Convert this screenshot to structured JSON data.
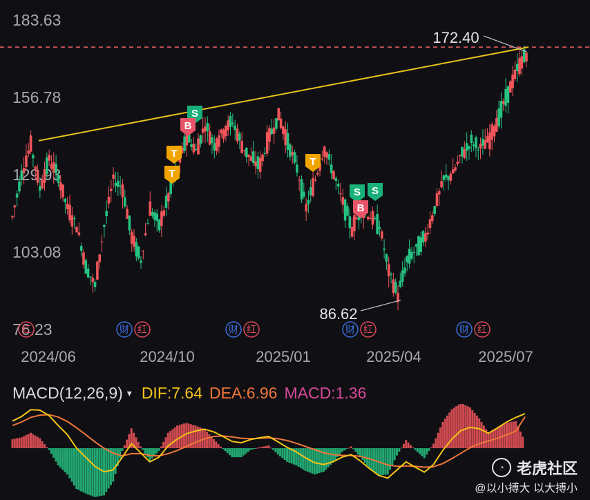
{
  "colors": {
    "background": "#101014",
    "up": "#f0555a",
    "down": "#26c281",
    "trendline": "#e8c21a",
    "ref_line": "#e35d5d",
    "axis_text": "#a8a8b0",
    "dif": "#f5c518",
    "dea": "#f0763a",
    "macd": "#d64a9a",
    "badge_T": "#f0a500",
    "badge_S": "#19b07a",
    "badge_B": "#ea5468",
    "event_blue": "#3c6fe0",
    "event_red": "#e0485a"
  },
  "chart_data": [
    {
      "type": "candlestick",
      "y_ticks": [
        "183.63",
        "156.78",
        "129.93",
        "103.08",
        "76.23"
      ],
      "ylim": [
        76.23,
        183.63
      ],
      "x_ticks": [
        "2024/06",
        "2024/10",
        "2025/01",
        "2025/04",
        "2025/07"
      ],
      "annotations": {
        "high_label": "172.40",
        "high_value": 172.4,
        "low_label": "86.62",
        "low_value": 86.62
      },
      "reference_line": 174.0,
      "trendline": {
        "start": [
          "2024/06",
          141.5
        ],
        "end": [
          "2025/07",
          174.0
        ]
      },
      "series": [
        {
          "d": "2024/05",
          "v": 115
        },
        {
          "d": "2024/06",
          "v": 130
        },
        {
          "d": "2024/06",
          "v": 140
        },
        {
          "d": "2024/06",
          "v": 125
        },
        {
          "d": "2024/06",
          "v": 135
        },
        {
          "d": "2024/06",
          "v": 129
        },
        {
          "d": "2024/07",
          "v": 118
        },
        {
          "d": "2024/07",
          "v": 112
        },
        {
          "d": "2024/07",
          "v": 98
        },
        {
          "d": "2024/07",
          "v": 91
        },
        {
          "d": "2024/08",
          "v": 112
        },
        {
          "d": "2024/08",
          "v": 128
        },
        {
          "d": "2024/08",
          "v": 125
        },
        {
          "d": "2024/09",
          "v": 108
        },
        {
          "d": "2024/09",
          "v": 100
        },
        {
          "d": "2024/09",
          "v": 118
        },
        {
          "d": "2024/09",
          "v": 112
        },
        {
          "d": "2024/10",
          "v": 122
        },
        {
          "d": "2024/10",
          "v": 132
        },
        {
          "d": "2024/10",
          "v": 143
        },
        {
          "d": "2024/10",
          "v": 138
        },
        {
          "d": "2024/11",
          "v": 147
        },
        {
          "d": "2024/11",
          "v": 140
        },
        {
          "d": "2024/11",
          "v": 145
        },
        {
          "d": "2024/12",
          "v": 148
        },
        {
          "d": "2024/12",
          "v": 140
        },
        {
          "d": "2024/12",
          "v": 135
        },
        {
          "d": "2024/12",
          "v": 133
        },
        {
          "d": "2025/01",
          "v": 143
        },
        {
          "d": "2025/01",
          "v": 150
        },
        {
          "d": "2025/01",
          "v": 141
        },
        {
          "d": "2025/01",
          "v": 132
        },
        {
          "d": "2025/02",
          "v": 118
        },
        {
          "d": "2025/02",
          "v": 128
        },
        {
          "d": "2025/02",
          "v": 139
        },
        {
          "d": "2025/02",
          "v": 130
        },
        {
          "d": "2025/03",
          "v": 120
        },
        {
          "d": "2025/03",
          "v": 111
        },
        {
          "d": "2025/03",
          "v": 118
        },
        {
          "d": "2025/03",
          "v": 115
        },
        {
          "d": "2025/03",
          "v": 112
        },
        {
          "d": "2025/04",
          "v": 96
        },
        {
          "d": "2025/04",
          "v": 88
        },
        {
          "d": "2025/04",
          "v": 100
        },
        {
          "d": "2025/04",
          "v": 104
        },
        {
          "d": "2025/04",
          "v": 108
        },
        {
          "d": "2025/05",
          "v": 118
        },
        {
          "d": "2025/05",
          "v": 128
        },
        {
          "d": "2025/05",
          "v": 130
        },
        {
          "d": "2025/06",
          "v": 137
        },
        {
          "d": "2025/06",
          "v": 141
        },
        {
          "d": "2025/06",
          "v": 139
        },
        {
          "d": "2025/06",
          "v": 142
        },
        {
          "d": "2025/07",
          "v": 150
        },
        {
          "d": "2025/07",
          "v": 158
        },
        {
          "d": "2025/07",
          "v": 166
        },
        {
          "d": "2025/07",
          "v": 172
        }
      ],
      "signals": [
        {
          "label": "S",
          "idx": 21,
          "kind": "S"
        },
        {
          "label": "B",
          "idx": 20,
          "kind": "B"
        },
        {
          "label": "T",
          "idx": 18,
          "kind": "T"
        },
        {
          "label": "T",
          "idx": 17,
          "kind": "T"
        },
        {
          "label": "T",
          "idx": 32,
          "kind": "T"
        },
        {
          "label": "S",
          "idx": 37,
          "kind": "S"
        },
        {
          "label": "S",
          "idx": 39,
          "kind": "S"
        },
        {
          "label": "B",
          "idx": 37,
          "kind": "B"
        }
      ],
      "events": [
        {
          "x": "2024/06",
          "marks": [
            "财",
            "红"
          ]
        },
        {
          "x": "2024/09",
          "marks": [
            "财",
            "红"
          ]
        },
        {
          "x": "2024/12",
          "marks": [
            "财",
            "红"
          ]
        },
        {
          "x": "2025/03",
          "marks": [
            "财",
            "红"
          ]
        },
        {
          "x": "2025/06",
          "marks": [
            "财",
            "红"
          ]
        }
      ]
    },
    {
      "type": "macd",
      "title": "MACD(12,26,9)",
      "dif_label": "DIF:7.64",
      "dea_label": "DEA:6.96",
      "macd_label": "MACD:1.36",
      "dif": [
        6,
        7,
        8.5,
        8.4,
        7.2,
        5,
        3,
        0,
        -2,
        -4,
        -5.2,
        -4.8,
        -2,
        1,
        -1,
        -3,
        -2,
        0.5,
        2,
        3.2,
        3.8,
        4.2,
        3.6,
        2.6,
        1.5,
        1.2,
        1.9,
        2.3,
        2.6,
        1.4,
        0.2,
        -0.8,
        -2.1,
        -3.2,
        -3.6,
        -3,
        -2,
        -1.4,
        -2.8,
        -4.5,
        -6,
        -6.6,
        -4.8,
        -3,
        -4.2,
        -5.3,
        -3.6,
        -0.5,
        2,
        3.9,
        4.6,
        4.3,
        3.3,
        4.5,
        5.8,
        6.8,
        7.64
      ],
      "dea": [
        5,
        5.8,
        6.8,
        7.3,
        7.4,
        6.9,
        5.9,
        4.5,
        3,
        1.4,
        0,
        -1.1,
        -1.7,
        -1.2,
        -1.2,
        -1.6,
        -1.7,
        -1.2,
        -0.5,
        0.4,
        1.3,
        2.1,
        2.6,
        2.7,
        2.5,
        2.2,
        2.1,
        2.2,
        2.3,
        2.1,
        1.7,
        1.1,
        0.4,
        -0.3,
        -1,
        -1.4,
        -1.6,
        -1.6,
        -1.8,
        -2.3,
        -3,
        -3.7,
        -4,
        -3.9,
        -4,
        -4.2,
        -4.1,
        -3.4,
        -2.3,
        -1.1,
        0.1,
        1,
        1.6,
        2.2,
        3,
        3.8,
        6.96
      ],
      "ylim": [
        -8,
        10
      ]
    }
  ],
  "macd_header": {
    "title": "MACD(12,26,9)",
    "arrow": "▾",
    "dif": "DIF:7.64",
    "dea": "DEA:6.96",
    "macd": "MACD:1.36"
  },
  "watermark": {
    "brand": "老虎社区",
    "logo": "icon-tiger",
    "handle": "@以小搏大 以大搏小"
  }
}
